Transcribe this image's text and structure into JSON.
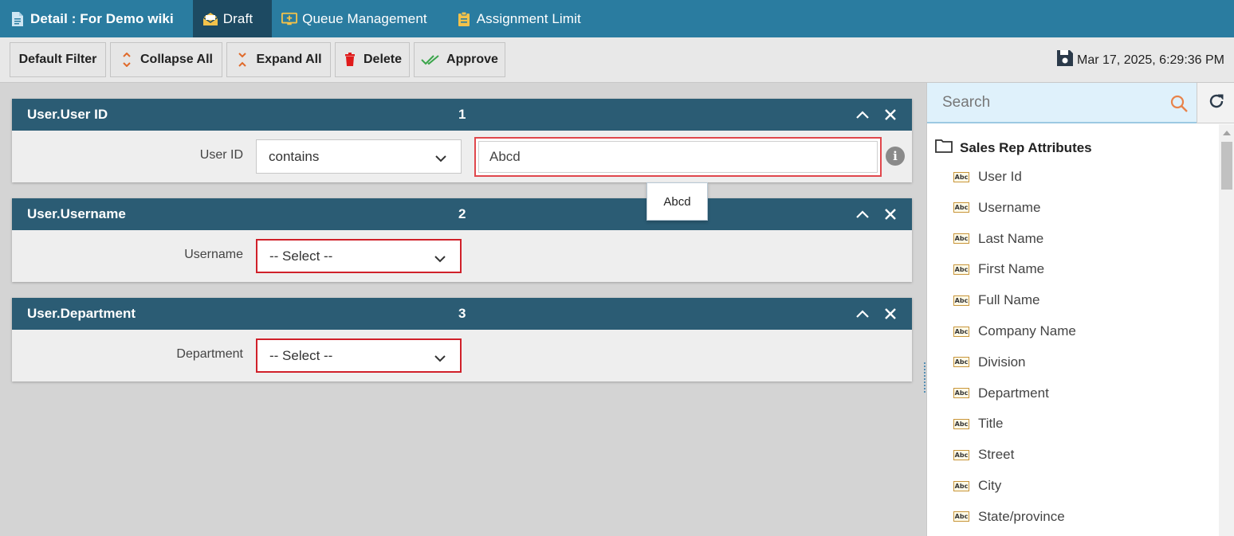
{
  "tabs": [
    {
      "label": "Detail : For Demo wiki",
      "icon": "document-icon",
      "active": false
    },
    {
      "label": "Draft",
      "icon": "envelope-open-icon",
      "active": true
    },
    {
      "label": "Queue Management",
      "icon": "monitor-plus-icon",
      "active": false
    },
    {
      "label": "Assignment Limit",
      "icon": "clipboard-icon",
      "active": false
    }
  ],
  "toolbar": {
    "default_filter": "Default Filter",
    "collapse_all": "Collapse All",
    "expand_all": "Expand All",
    "delete": "Delete",
    "approve": "Approve",
    "timestamp": "Mar 17, 2025, 6:29:36 PM"
  },
  "filters": [
    {
      "title": "User.User ID",
      "number": "1",
      "label": "User ID",
      "operator": "contains",
      "value": "Abcd"
    },
    {
      "title": "User.Username",
      "number": "2",
      "label": "Username",
      "operator": "-- Select --"
    },
    {
      "title": "User.Department",
      "number": "3",
      "label": "Department",
      "operator": "-- Select --"
    }
  ],
  "suggestion": "Abcd",
  "search": {
    "placeholder": "Search"
  },
  "tree": {
    "root": "Sales Rep Attributes",
    "items": [
      "User Id",
      "Username",
      "Last Name",
      "First Name",
      "Full Name",
      "Company Name",
      "Division",
      "Department",
      "Title",
      "Street",
      "City",
      "State/province"
    ]
  },
  "colors": {
    "tabbar": "#2a7ca0",
    "active_tab": "#1d4a62",
    "card_header": "#2b5c74",
    "error_border": "#d0202a"
  }
}
